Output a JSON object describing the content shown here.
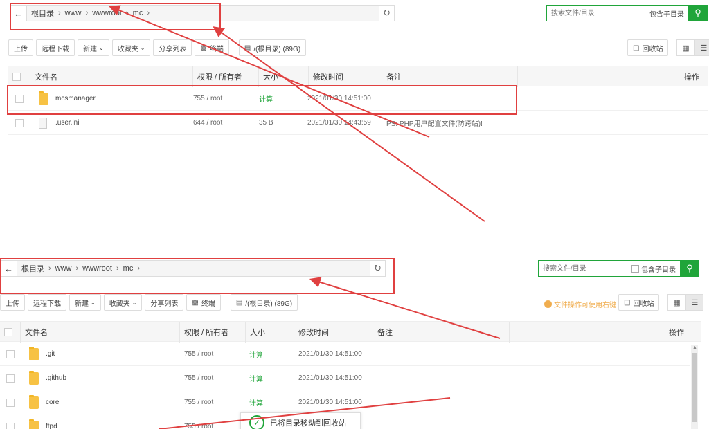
{
  "panel1": {
    "path": [
      "根目录",
      "www",
      "wwwroot",
      "mc"
    ],
    "search": {
      "placeholder": "搜索文件/目录",
      "sub_label": "包含子目录"
    },
    "toolbar": [
      "上传",
      "远程下载",
      "新建",
      "收藏夹",
      "分享列表",
      "终端",
      "/(根目录) (89G)"
    ],
    "recycle": "回收站",
    "columns": [
      "文件名",
      "权限 / 所有者",
      "大小",
      "修改时间",
      "备注",
      "操作"
    ],
    "rows": [
      {
        "name": "mcsmanager",
        "type": "folder",
        "perm": "755 / root",
        "size": "计算",
        "mtime": "2021/01/30 14:51:00",
        "note": ""
      },
      {
        "name": ".user.ini",
        "type": "file",
        "perm": "644 / root",
        "size": "35 B",
        "mtime": "2021/01/30 14:43:59",
        "note": "PS: PHP用户配置文件(防跨站)!"
      }
    ]
  },
  "panel2": {
    "path": [
      "根目录",
      "www",
      "wwwroot",
      "mc"
    ],
    "search": {
      "placeholder": "搜索文件/目录",
      "sub_label": "包含子目录"
    },
    "toolbar": [
      "上传",
      "远程下载",
      "新建",
      "收藏夹",
      "分享列表",
      "终端",
      "/(根目录) (89G)"
    ],
    "hint": "文件操作可使用右键",
    "recycle": "回收站",
    "columns": [
      "文件名",
      "权限 / 所有者",
      "大小",
      "修改时间",
      "备注",
      "操作"
    ],
    "rows": [
      {
        "name": ".git",
        "type": "folder",
        "perm": "755 / root",
        "size": "计算",
        "mtime": "2021/01/30 14:51:00"
      },
      {
        "name": ".github",
        "type": "folder",
        "perm": "755 / root",
        "size": "计算",
        "mtime": "2021/01/30 14:51:00"
      },
      {
        "name": "core",
        "type": "folder",
        "perm": "755 / root",
        "size": "计算",
        "mtime": "2021/01/30 14:51:00"
      },
      {
        "name": "ftpd",
        "type": "folder",
        "perm": "755 / root",
        "size": "",
        "mtime": ""
      }
    ]
  },
  "toast": "已将目录移动到回收站",
  "colors": {
    "accent": "#20a53a",
    "annotation": "#e04040",
    "folder": "#f7c244"
  }
}
